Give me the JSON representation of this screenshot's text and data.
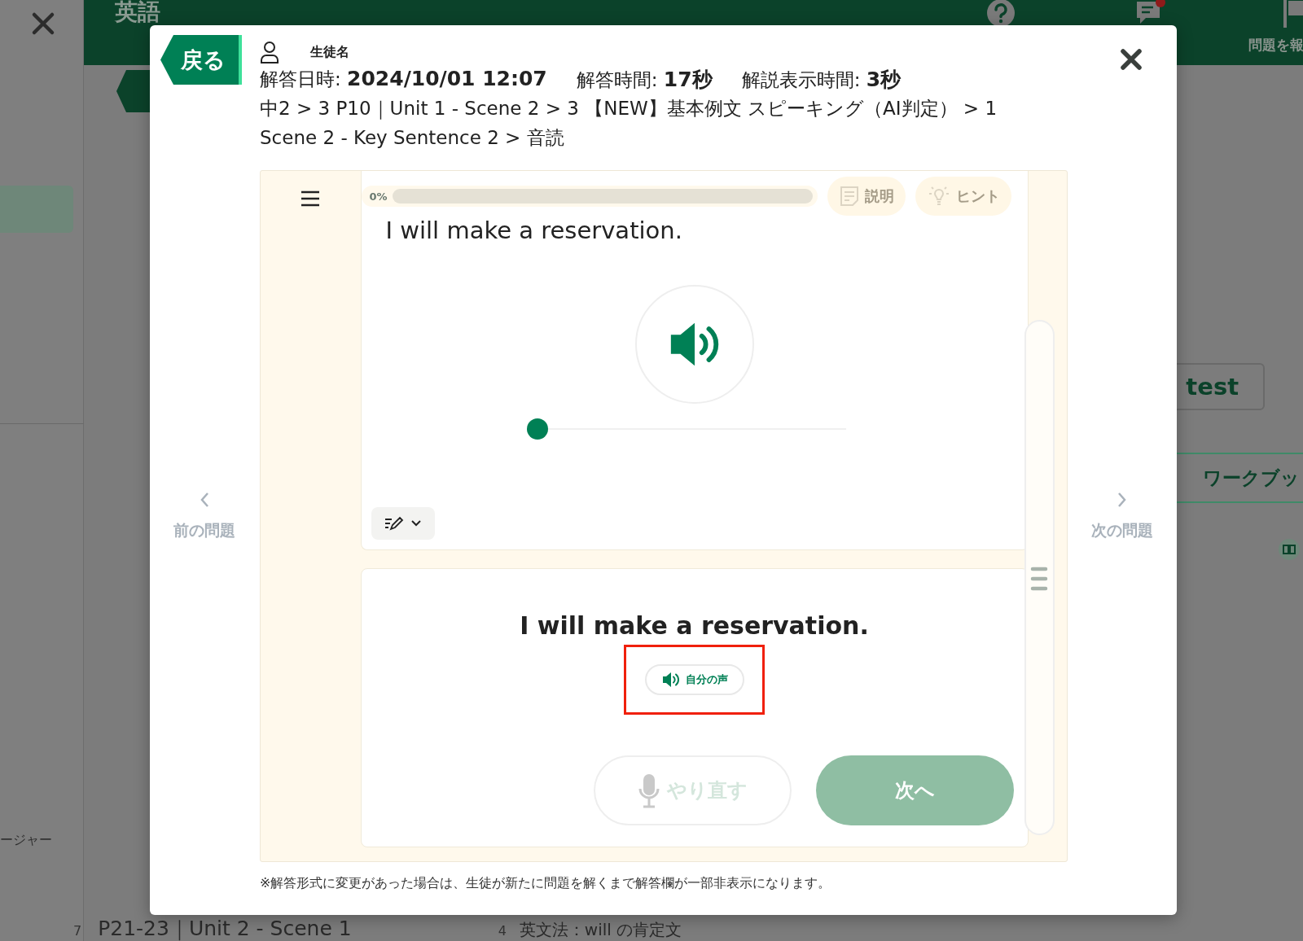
{
  "background": {
    "header_title": "英語",
    "report_label": "問題を報",
    "notification": true,
    "side_label": "ージャー",
    "test_button": "test",
    "workbook_tab": "ワークブッ",
    "rows": [
      {
        "number": "7",
        "title": "P21-23｜Unit 2 - Scene 1"
      },
      {
        "number": "4",
        "title": "英文法：will の肯定文"
      }
    ]
  },
  "dialog": {
    "back_button": "戻る",
    "student_name": "生徒名",
    "meta": [
      {
        "label": "解答日時: ",
        "value": "2024/10/01 12:07"
      },
      {
        "label": "解答時間: ",
        "value": "17秒"
      },
      {
        "label": "解説表示時間: ",
        "value": "3秒"
      }
    ],
    "breadcrumb": "中2 > 3 P10｜Unit 1 - Scene 2 > 3 【NEW】基本例文 スピーキング（AI判定） > 1 Scene 2 - Key Sentence 2 > 音読",
    "prev_label": "前の問題",
    "next_label": "次の問題",
    "player": {
      "progress_label": "0%",
      "progress": {
        "level": 0
      },
      "tools": [
        {
          "kind": "explain",
          "label": "説明",
          "disabled": true
        },
        {
          "kind": "hint",
          "label": "ヒント",
          "disabled": true
        }
      ],
      "prompt": "I will make a reservation.",
      "audio": {
        "level": 0
      },
      "answer": "I will make a reservation.",
      "own_voice": "自分の声",
      "own_voice_highlighted": true,
      "actions": [
        {
          "kind": "retry",
          "label": "やり直す",
          "disabled": true
        },
        {
          "kind": "next",
          "label": "次へ",
          "disabled": true
        }
      ]
    },
    "note": "※解答形式に変更があった場合は、生徒が新たに問題を解くまで解答欄が一部非表示になります。"
  }
}
